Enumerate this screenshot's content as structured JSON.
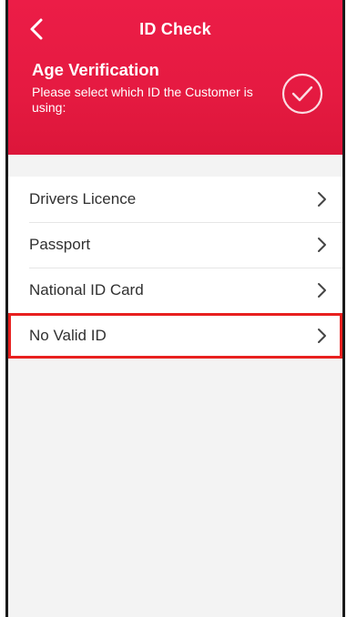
{
  "header": {
    "back_icon": "chevron-left-icon",
    "title": "ID Check",
    "section_title": "Age Verification",
    "section_subtitle": "Please select which ID the Customer is using:",
    "status_icon": "check-circle-icon",
    "background_color": "#e51a41"
  },
  "id_options": [
    {
      "label": "Drivers Licence",
      "icon": "chevron-right-icon"
    },
    {
      "label": "Passport",
      "icon": "chevron-right-icon"
    },
    {
      "label": "National ID Card",
      "icon": "chevron-right-icon"
    },
    {
      "label": "No Valid ID",
      "icon": "chevron-right-icon",
      "highlighted": true
    }
  ],
  "colors": {
    "accent": "#e51a41",
    "highlight_border": "#e8201f",
    "list_background": "#ffffff",
    "page_background": "#f3f3f3"
  }
}
